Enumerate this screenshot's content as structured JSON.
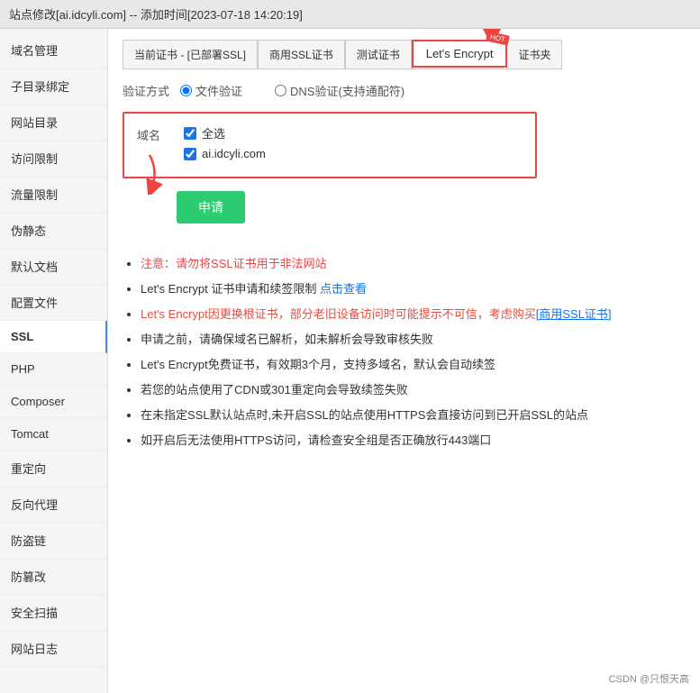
{
  "titleBar": {
    "text": "站点修改[ai.idcyli.com] -- 添加时间[2023-07-18 14:20:19]"
  },
  "sidebar": {
    "items": [
      {
        "id": "domain",
        "label": "域名管理"
      },
      {
        "id": "subdir",
        "label": "子目录绑定"
      },
      {
        "id": "sitedir",
        "label": "网站目录"
      },
      {
        "id": "access",
        "label": "访问限制"
      },
      {
        "id": "traffic",
        "label": "流量限制"
      },
      {
        "id": "pseudostatic",
        "label": "伪静态"
      },
      {
        "id": "defaultdoc",
        "label": "默认文档"
      },
      {
        "id": "config",
        "label": "配置文件"
      },
      {
        "id": "ssl",
        "label": "SSL",
        "active": true
      },
      {
        "id": "php",
        "label": "PHP"
      },
      {
        "id": "composer",
        "label": "Composer"
      },
      {
        "id": "tomcat",
        "label": "Tomcat"
      },
      {
        "id": "redirect",
        "label": "重定向"
      },
      {
        "id": "reverseproxy",
        "label": "反向代理"
      },
      {
        "id": "hotlink",
        "label": "防盗链"
      },
      {
        "id": "tamper",
        "label": "防篡改"
      },
      {
        "id": "securityscan",
        "label": "安全扫描"
      },
      {
        "id": "sitelog",
        "label": "网站日志"
      }
    ]
  },
  "tabs": [
    {
      "id": "current",
      "label": "当前证书 - [已部署SSL]",
      "active": false
    },
    {
      "id": "commercial",
      "label": "商用SSL证书",
      "active": false
    },
    {
      "id": "test",
      "label": "测试证书",
      "active": false
    },
    {
      "id": "letsencrypt",
      "label": "Let's Encrypt",
      "active": true,
      "highlight": true
    },
    {
      "id": "certfolder",
      "label": "证书夹",
      "active": false
    }
  ],
  "verifyMethod": {
    "label": "验证方式",
    "options": [
      {
        "id": "file",
        "label": "文件验证",
        "selected": true
      },
      {
        "id": "dns",
        "label": "DNS验证(支持通配符)",
        "selected": false
      }
    ]
  },
  "domainBox": {
    "label": "域名",
    "items": [
      {
        "id": "selectall",
        "label": "全选",
        "checked": true
      },
      {
        "id": "domain1",
        "label": "ai.idcyli.com",
        "checked": true
      }
    ]
  },
  "applyButton": {
    "label": "申请"
  },
  "infoList": [
    {
      "id": "note1",
      "text": "注意：请勿将SSL证书用于非法网站",
      "class": "red"
    },
    {
      "id": "note2",
      "prefix": "Let's Encrypt 证书申请和续签限制 ",
      "linkText": "点击查看",
      "suffix": ""
    },
    {
      "id": "note3",
      "text": "Let's Encrypt因更换根证书，部分老旧设备访问时可能提示不可信，考虑购买[商用SSL证书]",
      "class": "orange-red"
    },
    {
      "id": "note4",
      "text": "申请之前，请确保域名已解析，如未解析会导致审核失败"
    },
    {
      "id": "note5",
      "text": "Let's Encrypt免费证书，有效期3个月，支持多域名，默认会自动续签"
    },
    {
      "id": "note6",
      "text": "若您的站点使用了CDN或301重定向会导致续签失败"
    },
    {
      "id": "note7",
      "text": "在未指定SSL默认站点时,未开启SSL的站点使用HTTPS会直接访问到已开启SSL的站点"
    },
    {
      "id": "note8",
      "text": "如开启后无法使用HTTPS访问，请检查安全组是否正确放行443端口"
    }
  ],
  "watermark": "CSDN @只恨天高"
}
